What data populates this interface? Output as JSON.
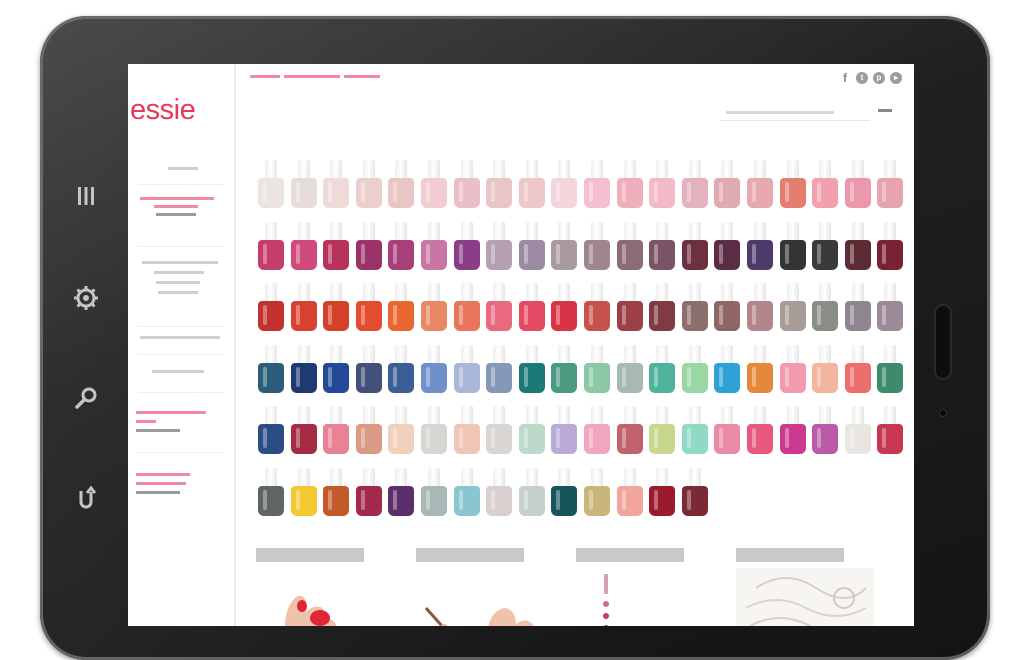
{
  "brand": {
    "logo": "essie",
    "color": "#e7375d"
  },
  "nav": {
    "items": [
      {
        "label": "",
        "sub": "",
        "style": "gray"
      },
      {
        "label": "",
        "sub": "",
        "style": "pink"
      },
      {
        "label": "",
        "sub": "",
        "style": "gray"
      },
      {
        "label": "",
        "sub": "",
        "style": "gray"
      },
      {
        "label": "",
        "sub": "",
        "style": "gray"
      },
      {
        "label": "",
        "sub": "",
        "style": "pink"
      },
      {
        "label": "",
        "sub": "",
        "style": "pink"
      }
    ]
  },
  "header": {
    "breadcrumb": "",
    "social": [
      "f",
      "t",
      "p",
      "y"
    ],
    "search_placeholder": "",
    "search_button": ""
  },
  "device_icons": [
    "menu-icon",
    "gear-icon",
    "search-icon",
    "back-icon"
  ],
  "polish_rows": [
    [
      "#ece4e2",
      "#e6dcd9",
      "#eedbd8",
      "#ebcfcc",
      "#e7c6c3",
      "#f1ccd0",
      "#ebbfc7",
      "#e8c5c7",
      "#eec7cb",
      "#f3d5db",
      "#f4c0cf",
      "#eeaebb",
      "#f2b9c8",
      "#e4b2bd",
      "#e0aab1",
      "#e7a9ae",
      "#e37e6f",
      "#f1a0ae",
      "#ec98ac",
      "#e7a4b0"
    ],
    [
      "#c63c6b",
      "#cf4a7a",
      "#b8325c",
      "#9c3269",
      "#a83f78",
      "#c776a6",
      "#8a3d89",
      "#b6a0b1",
      "#9c8aa3",
      "#a99a9e",
      "#9f8590",
      "#8c6a77",
      "#7a5464",
      "#6e2f41",
      "#5b2c44",
      "#4c3a6b",
      "#343435",
      "#3a3b38",
      "#5d2b34",
      "#7b2135"
    ],
    [
      "#c2322e",
      "#d9402f",
      "#d5402b",
      "#e24d2f",
      "#e7672e",
      "#e78763",
      "#e8765c",
      "#e96a7f",
      "#e44a63",
      "#d93347",
      "#c7524d",
      "#9d3f46",
      "#7f3a42",
      "#8a6f6d",
      "#8e6765",
      "#b4858d",
      "#a89c96",
      "#8a8d85",
      "#8e8590",
      "#9d8a98"
    ],
    [
      "#2a5d7a",
      "#1f3a72",
      "#224a96",
      "#44507c",
      "#3c5e98",
      "#6f90c9",
      "#aab6d9",
      "#8698b9",
      "#1b7a76",
      "#4a9b82",
      "#8cc8a6",
      "#a6bab3",
      "#4fb29c",
      "#9bd6a5",
      "#2ea2d6",
      "#e5883b",
      "#f19ab0",
      "#f3b4a0",
      "#ec6f6e",
      "#3f8a6a"
    ],
    [
      "#2b4c85",
      "#a52c43",
      "#e98294",
      "#d99b86",
      "#efd1bd",
      "#d8d6d2",
      "#f0c5b6",
      "#d9d5d2",
      "#bcd9c9",
      "#b8a9d6",
      "#f0a6bf",
      "#c1636f",
      "#c8d78e",
      "#8fd9c5",
      "#ea8aa4",
      "#e8587f",
      "#cc3a8f",
      "#bb5aa8",
      "#e9e5e1",
      "#c73754"
    ],
    [
      "#5f6662",
      "#f3c932",
      "#c35a2a",
      "#a3294a",
      "#5a2f6b",
      "#a9b7b6",
      "#8ac6d2",
      "#d9cfce",
      "#c6d0cf",
      "#16565a",
      "#c9b67a",
      "#f0a69c",
      "#9b1b2c",
      "#7a2a34"
    ]
  ],
  "promos": [
    {
      "label": ""
    },
    {
      "label": ""
    },
    {
      "label": ""
    },
    {
      "label": ""
    }
  ]
}
